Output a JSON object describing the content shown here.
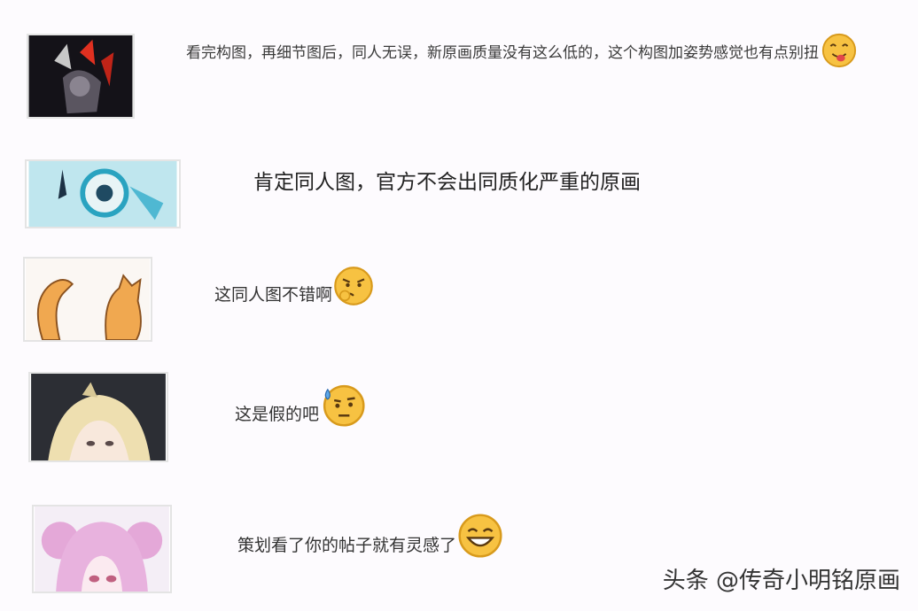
{
  "comments": [
    {
      "text": "看完构图，再细节图后，同人无误，新原画质量没有这么低的，这个构图加姿势感觉也有点别扭",
      "emoji": "tongue-out-emoji"
    },
    {
      "text": "肯定同人图，官方不会出同质化严重的原画",
      "emoji": ""
    },
    {
      "text": "这同人图不错啊",
      "emoji": "thinking-emoji"
    },
    {
      "text": "这是假的吧",
      "emoji": "sweat-doubt-emoji"
    },
    {
      "text": "策划看了你的帖子就有灵感了",
      "emoji": "grin-emoji"
    }
  ],
  "watermark": "头条 @传奇小明铭原画",
  "colors": {
    "emoji_fill": "#f7c242",
    "emoji_stroke": "#d89a1c",
    "background": "#fdfbfe"
  }
}
